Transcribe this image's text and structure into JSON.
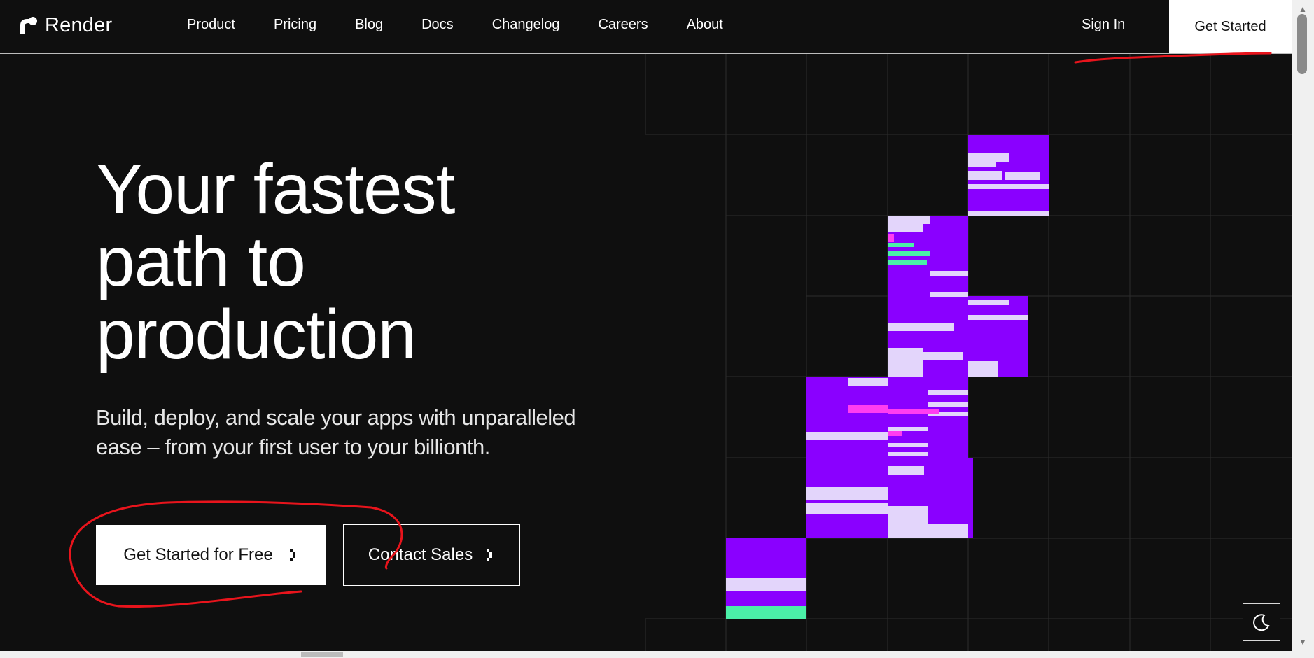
{
  "brand": {
    "name": "Render"
  },
  "nav": {
    "links": [
      "Product",
      "Pricing",
      "Blog",
      "Docs",
      "Changelog",
      "Careers",
      "About"
    ],
    "sign_in": "Sign In",
    "get_started": "Get Started"
  },
  "hero": {
    "title_lines": [
      "Your fastest",
      "path to",
      "production"
    ],
    "subtitle_lines": [
      "Build, deploy, and scale your apps with unparalleled",
      "ease – from your first user to your billionth."
    ],
    "cta_primary": "Get Started for Free",
    "cta_secondary": "Contact Sales"
  },
  "icons": {
    "chevron": "chevron-right-icon",
    "theme": "moon-icon",
    "logo": "render-logo-icon"
  },
  "colors": {
    "background": "#0f0f0f",
    "accent_purple": "#8a00ff",
    "accent_light": "#e3d5fb",
    "accent_pink": "#ff3df0",
    "accent_green": "#4bf0a8",
    "annotation_red": "#e8141c"
  }
}
